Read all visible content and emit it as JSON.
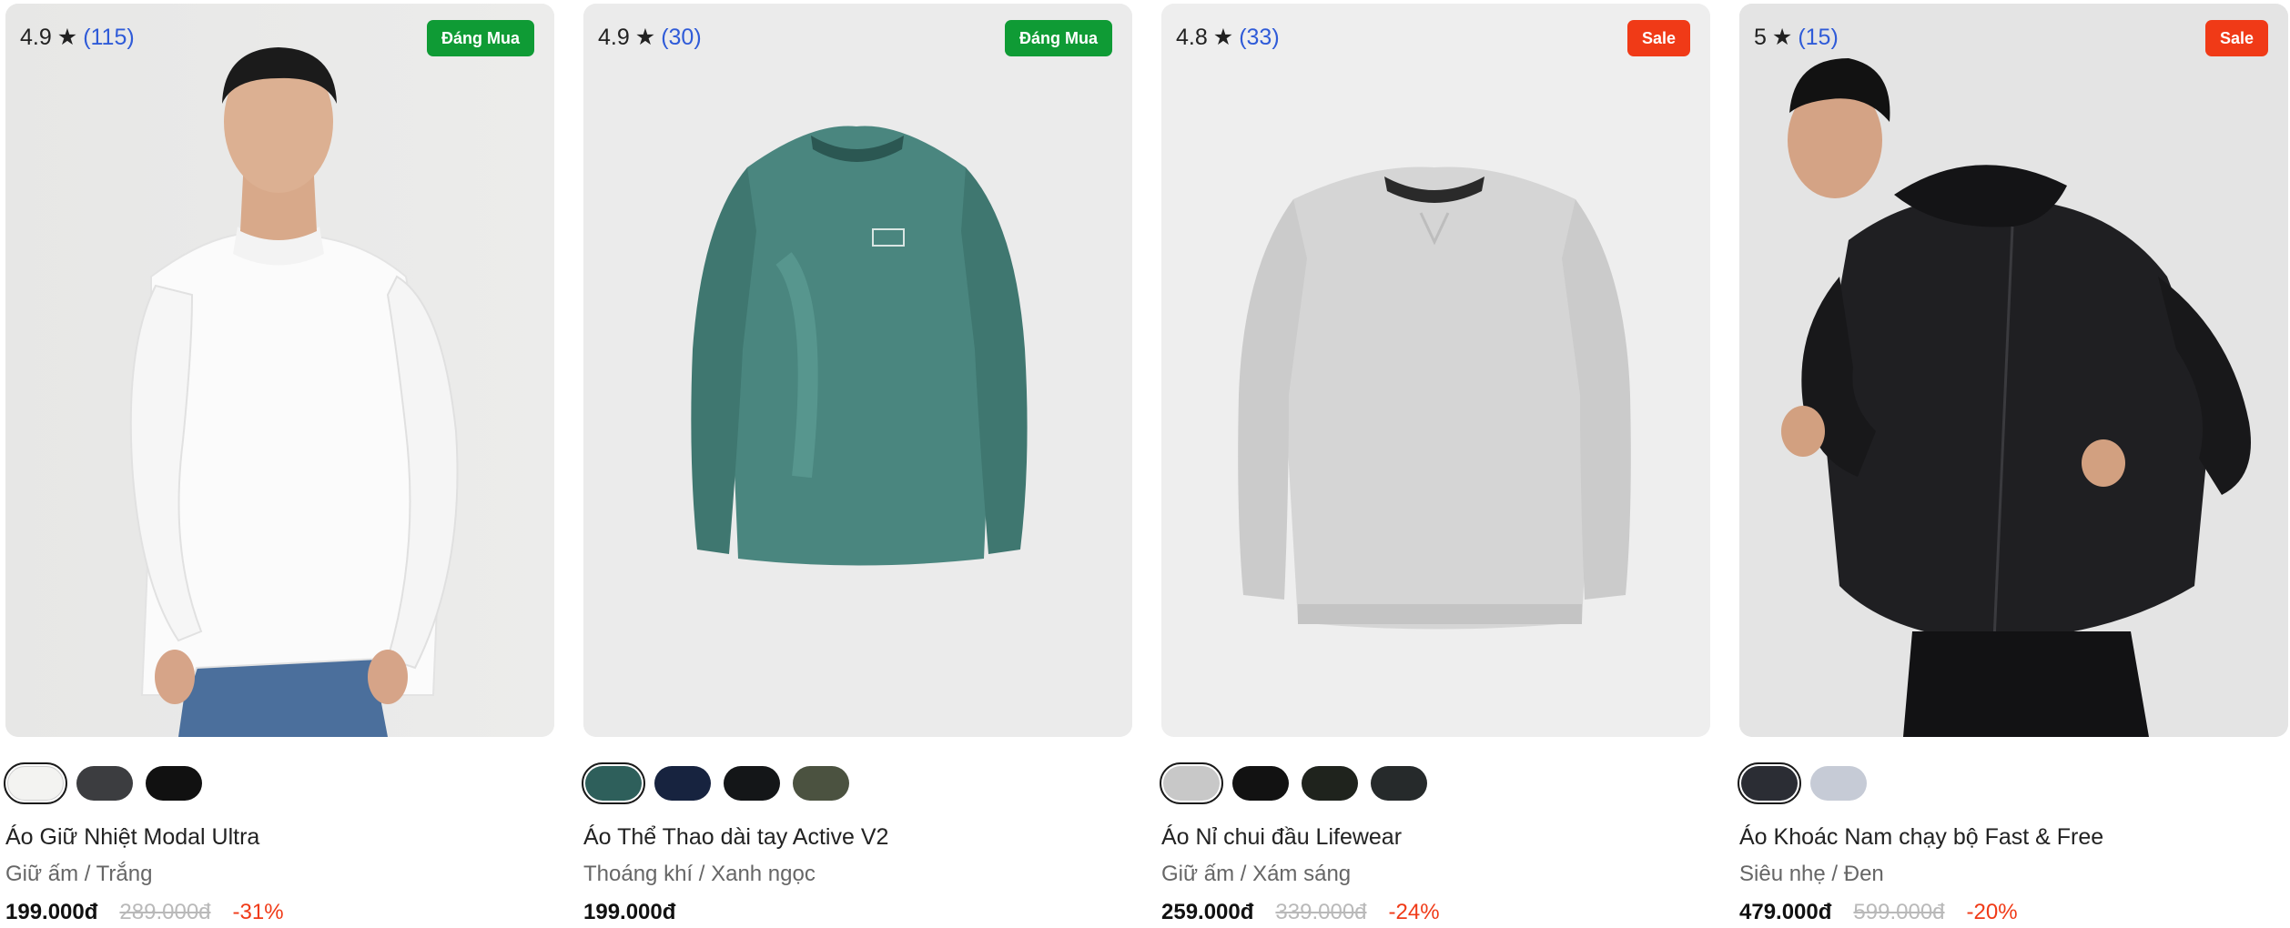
{
  "products": [
    {
      "rating": "4.9",
      "star": "★",
      "review_count": "(115)",
      "badge": "Đáng Mua",
      "badge_color": "#0f9b35",
      "image": "man-white-long-sleeve-turtleneck",
      "swatches": [
        {
          "color": "#f3f3f1",
          "selected": true
        },
        {
          "color": "#3c3d40",
          "selected": false
        },
        {
          "color": "#111111",
          "selected": false
        }
      ],
      "name": "Áo Giữ Nhiệt Modal Ultra",
      "subtitle": "Giữ ấm / Trắng",
      "price": "199.000đ",
      "old_price": "289.000đ",
      "discount": "-31%"
    },
    {
      "rating": "4.9",
      "star": "★",
      "review_count": "(30)",
      "badge": "Đáng Mua",
      "badge_color": "#0f9b35",
      "image": "teal-raglan-long-sleeve-tee",
      "swatches": [
        {
          "color": "#2e5f5b",
          "selected": true
        },
        {
          "color": "#17233f",
          "selected": false
        },
        {
          "color": "#141618",
          "selected": false
        },
        {
          "color": "#4b5240",
          "selected": false
        }
      ],
      "name": "Áo Thể Thao dài tay Active V2",
      "subtitle": "Thoáng khí / Xanh ngọc",
      "price": "199.000đ",
      "old_price": "",
      "discount": ""
    },
    {
      "rating": "4.8",
      "star": "★",
      "review_count": "(33)",
      "badge": "Sale",
      "badge_color": "#f03a17",
      "image": "light-grey-crewneck-sweatshirt",
      "swatches": [
        {
          "color": "#c8c8c8",
          "selected": true
        },
        {
          "color": "#121212",
          "selected": false
        },
        {
          "color": "#1f231d",
          "selected": false
        },
        {
          "color": "#262a2b",
          "selected": false
        }
      ],
      "name": "Áo Nỉ chui đầu Lifewear",
      "subtitle": "Giữ ấm / Xám sáng",
      "price": "259.000đ",
      "old_price": "339.000đ",
      "discount": "-24%"
    },
    {
      "rating": "5",
      "star": "★",
      "review_count": "(15)",
      "badge": "Sale",
      "badge_color": "#f03a17",
      "image": "man-running-black-windbreaker",
      "swatches": [
        {
          "color": "#2b2d34",
          "selected": true
        },
        {
          "color": "#c6cbd6",
          "selected": false
        }
      ],
      "name": "Áo Khoác Nam chạy bộ Fast & Free",
      "subtitle": "Siêu nhẹ / Đen",
      "price": "479.000đ",
      "old_price": "599.000đ",
      "discount": "-20%"
    }
  ]
}
